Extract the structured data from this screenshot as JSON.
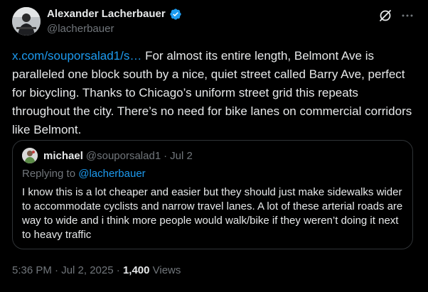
{
  "author": {
    "name": "Alexander Lacherbauer",
    "handle": "@lacherbauer",
    "verified": true
  },
  "icons": {
    "verified": "verified-badge-icon",
    "grok": "grok-icon",
    "more": "more-icon"
  },
  "colors": {
    "background": "#000000",
    "text": "#e7e9ea",
    "secondary": "#71767b",
    "link": "#1d9bf0",
    "border": "#2f3336"
  },
  "tweet": {
    "link_text": "x.com/souporsalad1/s…",
    "text": " For almost its entire length, Belmont Ave is paralleled one block south by a nice, quiet street called Barry Ave, perfect for bicycling. Thanks to Chicago’s uniform street grid this repeats throughout the city. There’s no need for bike lanes on commercial corridors like Belmont."
  },
  "quoted_tweet": {
    "name": "michael",
    "handle": "@souporsalad1",
    "separator": "·",
    "date": "Jul 2",
    "replying_label": "Replying to ",
    "replying_handle": "@lacherbauer",
    "text": "I know this is a lot cheaper and easier but they should just make sidewalks wider to accommodate cyclists and narrow travel lanes. A lot of these arterial roads are way to wide and i think more people would walk/bike if they weren’t doing it next to heavy traffic"
  },
  "meta": {
    "timestamp": "5:36 PM · Jul 2, 2025",
    "separator": " · ",
    "views_count": "1,400",
    "views_label": " Views"
  }
}
